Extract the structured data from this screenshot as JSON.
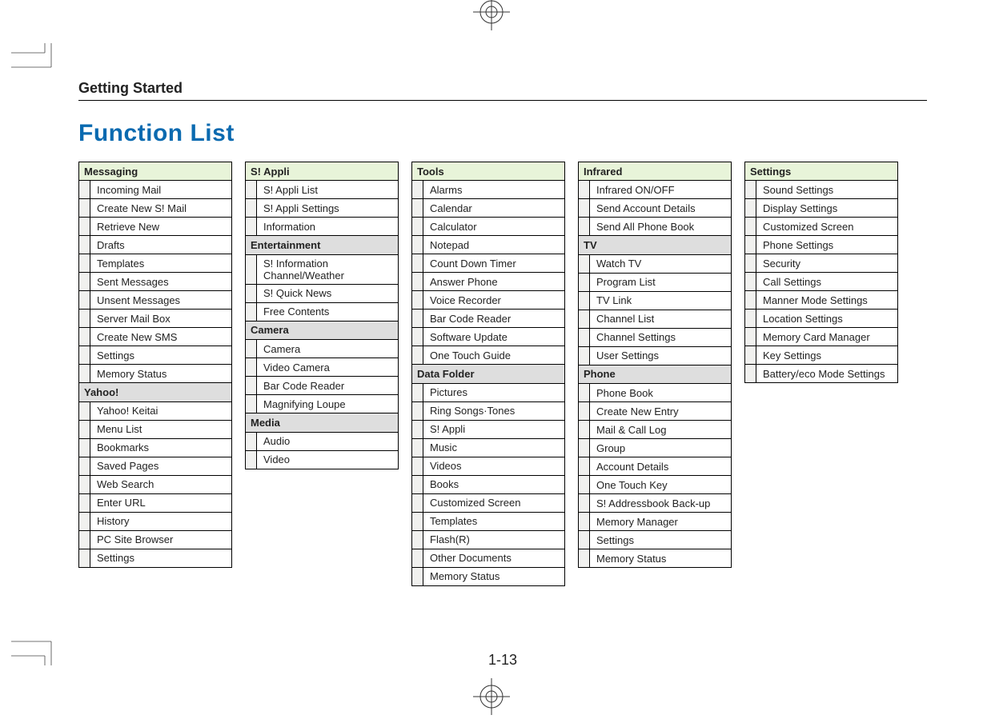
{
  "chapter": "Getting Started",
  "title": "Function List",
  "page_number": "1-13",
  "columns": [
    {
      "groups": [
        {
          "header": "Messaging",
          "style": "green",
          "items": [
            "Incoming Mail",
            "Create New S! Mail",
            "Retrieve New",
            "Drafts",
            "Templates",
            "Sent Messages",
            "Unsent Messages",
            "Server Mail Box",
            "Create New SMS",
            "Settings",
            "Memory Status"
          ]
        },
        {
          "header": "Yahoo!",
          "style": "gray",
          "items": [
            "Yahoo! Keitai",
            "Menu List",
            "Bookmarks",
            "Saved Pages",
            "Web Search",
            "Enter URL",
            "History",
            "PC Site Browser",
            "Settings"
          ]
        }
      ]
    },
    {
      "groups": [
        {
          "header": "S! Appli",
          "style": "green",
          "items": [
            "S! Appli List",
            "S! Appli Settings",
            "Information"
          ]
        },
        {
          "header": "Entertainment",
          "style": "gray",
          "items": [
            "S! Information Channel/Weather",
            "S! Quick News",
            "Free Contents"
          ]
        },
        {
          "header": "Camera",
          "style": "gray",
          "items": [
            "Camera",
            "Video Camera",
            "Bar Code Reader",
            "Magnifying Loupe"
          ]
        },
        {
          "header": "Media",
          "style": "gray",
          "items": [
            "Audio",
            "Video"
          ]
        }
      ]
    },
    {
      "groups": [
        {
          "header": "Tools",
          "style": "green",
          "items": [
            "Alarms",
            "Calendar",
            "Calculator",
            "Notepad",
            "Count Down Timer",
            "Answer Phone",
            "Voice Recorder",
            "Bar Code Reader",
            "Software Update",
            "One Touch Guide"
          ]
        },
        {
          "header": "Data Folder",
          "style": "gray",
          "items": [
            "Pictures",
            "Ring Songs·Tones",
            "S! Appli",
            "Music",
            "Videos",
            "Books",
            "Customized Screen",
            "Templates",
            "Flash(R)",
            "Other Documents",
            "Memory Status"
          ]
        }
      ]
    },
    {
      "groups": [
        {
          "header": "Infrared",
          "style": "green",
          "items": [
            "Infrared ON/OFF",
            "Send Account Details",
            "Send All Phone Book"
          ]
        },
        {
          "header": "TV",
          "style": "gray",
          "items": [
            "Watch TV",
            "Program List",
            "TV Link",
            "Channel List",
            "Channel Settings",
            "User Settings"
          ]
        },
        {
          "header": "Phone",
          "style": "gray",
          "items": [
            "Phone Book",
            "Create New Entry",
            "Mail & Call Log",
            "Group",
            "Account Details",
            "One Touch Key",
            "S! Addressbook Back-up",
            "Memory Manager",
            "Settings",
            "Memory Status"
          ]
        }
      ]
    },
    {
      "groups": [
        {
          "header": "Settings",
          "style": "green",
          "items": [
            "Sound Settings",
            "Display Settings",
            "Customized Screen",
            "Phone Settings",
            "Security",
            "Call Settings",
            "Manner Mode Settings",
            "Location Settings",
            "Memory Card Manager",
            "Key Settings",
            "Battery/eco Mode Settings"
          ]
        }
      ]
    }
  ]
}
